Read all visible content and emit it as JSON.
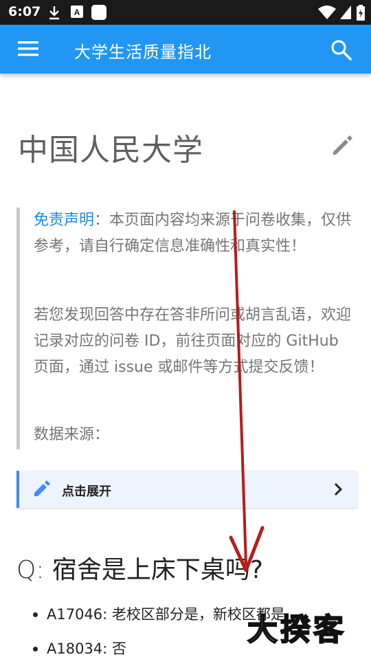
{
  "status_bar": {
    "time": "6:07"
  },
  "app_bar": {
    "title": "大学生活质量指北"
  },
  "page": {
    "title": "中国人民大学"
  },
  "disclaimer": {
    "link_label": "免责声明",
    "text": "：本页面内容均来源于问卷收集，仅供参考，请自行确定信息准确性和真实性！",
    "paragraph2": "若您发现回答中存在答非所问或胡言乱语，欢迎记录对应的问卷 ID，前往页面对应的 GitHub 页面，通过 issue 或邮件等方式提交反馈！",
    "data_source": "数据来源："
  },
  "expand_panel": {
    "label": "点击展开"
  },
  "question": {
    "prefix": "Q:",
    "text": "宿舍是上床下桌吗?",
    "answers": [
      "A17046: 老校区部分是，新校区都是",
      "A18034: 否"
    ]
  },
  "watermark": {
    "text": "大揆客"
  },
  "colors": {
    "app_bar": "#2196f3",
    "accent": "#448aff",
    "link": "#1e88e5",
    "annotation_arrow": "#b71c1c"
  }
}
